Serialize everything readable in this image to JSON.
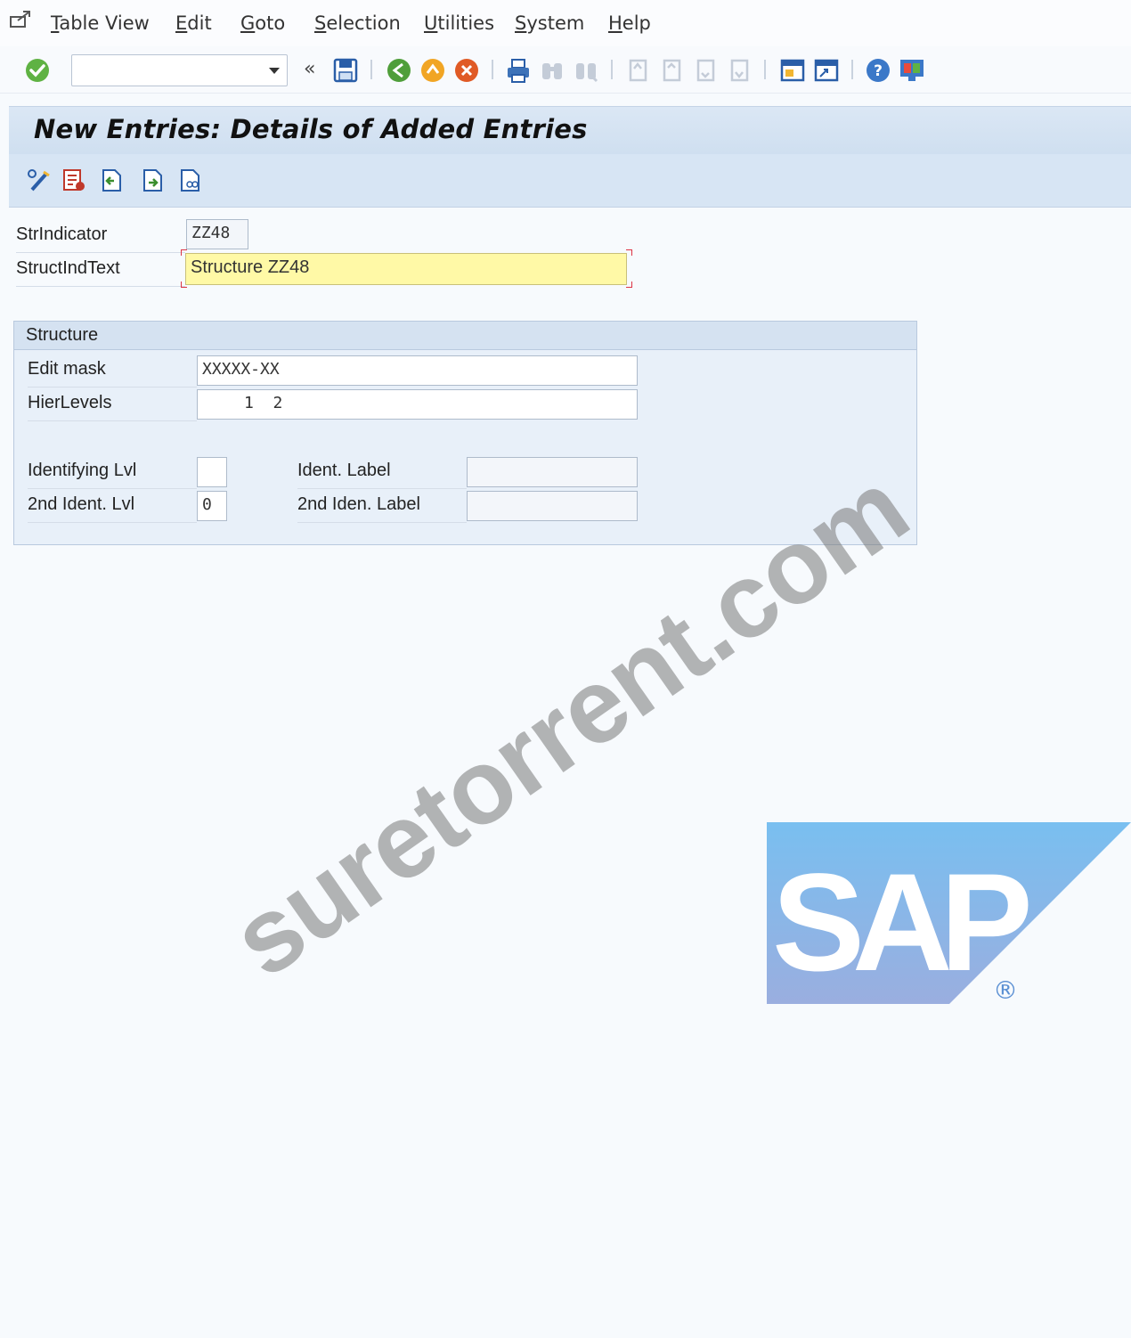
{
  "menu": {
    "items": [
      {
        "key": "T",
        "rest": "able View"
      },
      {
        "key": "E",
        "rest": "dit"
      },
      {
        "key": "G",
        "rest": "oto"
      },
      {
        "key": "S",
        "rest": "election"
      },
      {
        "key": "U",
        "rest": "tilities"
      },
      {
        "key": "S",
        "rest": "ystem"
      },
      {
        "key": "H",
        "rest": "elp"
      }
    ]
  },
  "toolbar": {
    "command_value": "",
    "back_glyph": "«"
  },
  "screen": {
    "title": "New Entries: Details of Added Entries"
  },
  "form": {
    "strindicator": {
      "label": "StrIndicator",
      "value": "ZZ48"
    },
    "structindtext": {
      "label": "StructIndText",
      "value": "Structure ZZ48"
    },
    "structure_group": {
      "title": "Structure",
      "edit_mask": {
        "label": "Edit mask",
        "value": "XXXXX-XX"
      },
      "hierlevels": {
        "label": "HierLevels",
        "value": "1  2"
      },
      "identifying_lvl": {
        "label": "Identifying Lvl",
        "value": ""
      },
      "ident_label": {
        "label": "Ident. Label",
        "value": ""
      },
      "second_ident_lvl": {
        "label": "2nd Ident. Lvl",
        "value": "0"
      },
      "second_iden_label": {
        "label": "2nd Iden. Label",
        "value": ""
      }
    }
  },
  "watermark": "suretorrent.com",
  "logo": {
    "text": "SAP",
    "registered": "®"
  },
  "colors": {
    "title_bg": "#d2e1f2",
    "required_field": "#fff9a6",
    "sap_blue_top": "#79bff0",
    "sap_blue_bottom": "#9aaedf"
  }
}
